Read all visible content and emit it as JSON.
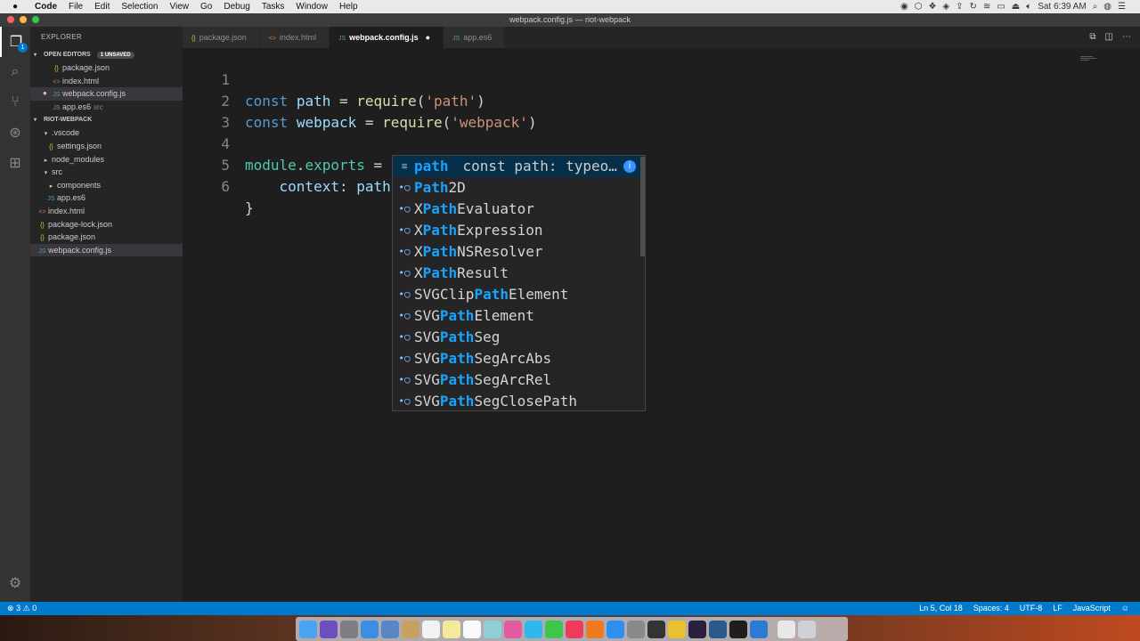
{
  "menubar": {
    "app": "Code",
    "items": [
      "File",
      "Edit",
      "Selection",
      "View",
      "Go",
      "Debug",
      "Tasks",
      "Window",
      "Help"
    ],
    "clock": "Sat 6:39 AM"
  },
  "window": {
    "title": "webpack.config.js — riot-webpack"
  },
  "activity": {
    "badge": "1"
  },
  "sidebar": {
    "title": "EXPLORER",
    "open_editors": {
      "title": "OPEN EDITORS",
      "badge": "1 UNSAVED",
      "items": [
        {
          "icon": "{}",
          "label": "package.json",
          "hint": ""
        },
        {
          "icon": "<>",
          "label": "index.html",
          "hint": ""
        },
        {
          "icon": "JS",
          "label": "webpack.config.js",
          "hint": ""
        },
        {
          "icon": "JS",
          "label": "app.es6",
          "hint": "src"
        }
      ]
    },
    "project": {
      "title": "RIOT-WEBPACK",
      "items": [
        {
          "twisty": "▾",
          "icon": "",
          "label": ".vscode"
        },
        {
          "twisty": "",
          "icon": "{}",
          "label": "settings.json"
        },
        {
          "twisty": "▸",
          "icon": "",
          "label": "node_modules"
        },
        {
          "twisty": "▾",
          "icon": "",
          "label": "src"
        },
        {
          "twisty": "▸",
          "icon": "",
          "label": "components"
        },
        {
          "twisty": "",
          "icon": "JS",
          "label": "app.es6"
        },
        {
          "twisty": "",
          "icon": "<>",
          "label": "index.html"
        },
        {
          "twisty": "",
          "icon": "{}",
          "label": "package-lock.json"
        },
        {
          "twisty": "",
          "icon": "{}",
          "label": "package.json"
        },
        {
          "twisty": "",
          "icon": "JS",
          "label": "webpack.config.js"
        }
      ]
    }
  },
  "tabs": [
    {
      "icon": "{}",
      "label": "package.json"
    },
    {
      "icon": "<>",
      "label": "index.html"
    },
    {
      "icon": "JS",
      "label": "webpack.config.js"
    },
    {
      "icon": "JS",
      "label": "app.es6"
    }
  ],
  "editor": {
    "line_numbers": [
      "1",
      "2",
      "3",
      "4",
      "5",
      "6"
    ],
    "l1": {
      "k": "const",
      "v": "path",
      "eq": " = ",
      "f": "require",
      "p1": "(",
      "s": "'path'",
      "p2": ")"
    },
    "l2": {
      "k": "const",
      "v": "webpack",
      "eq": " = ",
      "f": "require",
      "p1": "(",
      "s": "'webpack'",
      "p2": ")"
    },
    "l4": {
      "o": "module",
      "dot": ".",
      "v": "exports",
      "rest": " = {"
    },
    "l5": {
      "indent": "    ",
      "key": "context",
      "colon": ": ",
      "val": "path"
    },
    "l6": {
      "close": "}"
    }
  },
  "suggest": {
    "items": [
      {
        "icon": "≡",
        "pre": "",
        "hl": "path",
        "post": "",
        "detail": "const path: typeo…"
      },
      {
        "icon": "•○",
        "pre": "",
        "hl": "Path",
        "post": "2D",
        "detail": ""
      },
      {
        "icon": "•○",
        "pre": "X",
        "hl": "Path",
        "post": "Evaluator",
        "detail": ""
      },
      {
        "icon": "•○",
        "pre": "X",
        "hl": "Path",
        "post": "Expression",
        "detail": ""
      },
      {
        "icon": "•○",
        "pre": "X",
        "hl": "Path",
        "post": "NSResolver",
        "detail": ""
      },
      {
        "icon": "•○",
        "pre": "X",
        "hl": "Path",
        "post": "Result",
        "detail": ""
      },
      {
        "icon": "•○",
        "pre": "SVGClip",
        "hl": "Path",
        "post": "Element",
        "detail": ""
      },
      {
        "icon": "•○",
        "pre": "SVG",
        "hl": "Path",
        "post": "Element",
        "detail": ""
      },
      {
        "icon": "•○",
        "pre": "SVG",
        "hl": "Path",
        "post": "Seg",
        "detail": ""
      },
      {
        "icon": "•○",
        "pre": "SVG",
        "hl": "Path",
        "post": "SegArcAbs",
        "detail": ""
      },
      {
        "icon": "•○",
        "pre": "SVG",
        "hl": "Path",
        "post": "SegArcRel",
        "detail": ""
      },
      {
        "icon": "•○",
        "pre": "SVG",
        "hl": "Path",
        "post": "SegClosePath",
        "detail": ""
      }
    ],
    "info_icon": "i"
  },
  "status": {
    "errors": "3",
    "warnings": "0",
    "position": "Ln 5, Col 18",
    "spaces": "Spaces: 4",
    "encoding": "UTF-8",
    "eol": "LF",
    "language": "JavaScript"
  }
}
